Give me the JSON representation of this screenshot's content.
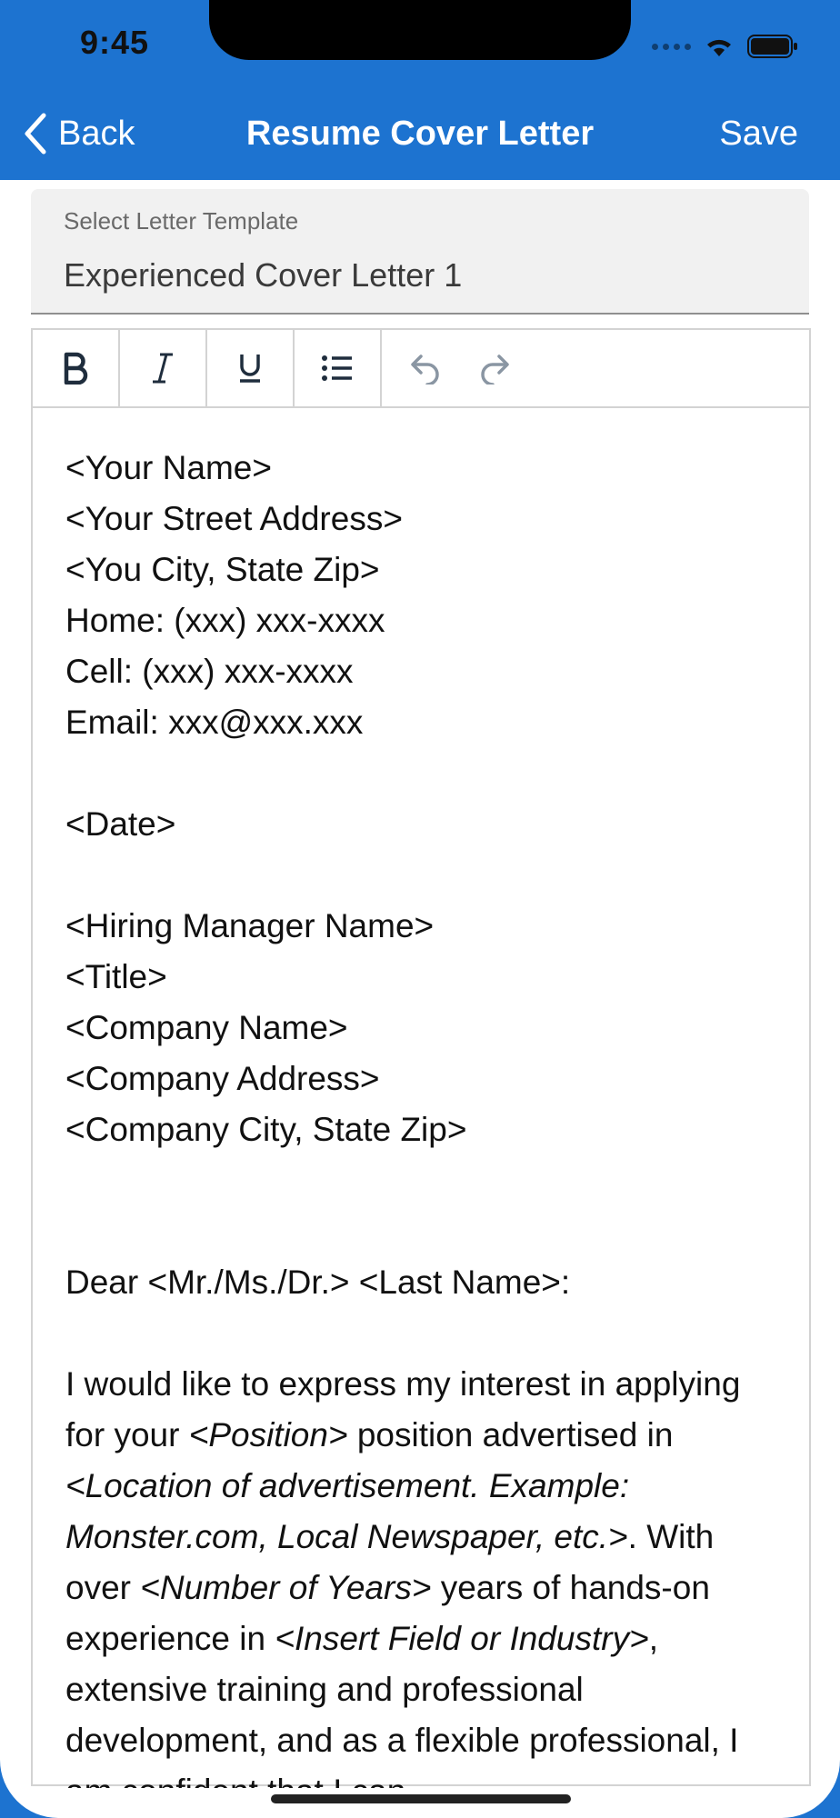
{
  "status_bar": {
    "time": "9:45"
  },
  "nav": {
    "back_label": "Back",
    "title": "Resume Cover Letter",
    "save_label": "Save"
  },
  "template": {
    "label": "Select Letter Template",
    "value": "Experienced Cover Letter 1"
  },
  "toolbar": {
    "buttons": [
      "bold-icon",
      "italic-icon",
      "underline-icon",
      "bullet-list-icon",
      "undo-icon",
      "redo-icon"
    ]
  },
  "letter": {
    "sender": [
      "<Your Name>",
      "<Your Street Address>",
      "<You City, State Zip>",
      "Home: (xxx) xxx-xxxx",
      "Cell: (xxx) xxx-xxxx",
      "Email: xxx@xxx.xxx"
    ],
    "date": "<Date>",
    "recipient": [
      "<Hiring Manager Name>",
      "<Title>",
      "<Company Name>",
      "<Company Address>",
      "<Company City, State Zip>"
    ],
    "salutation": "Dear <Mr./Ms./Dr.> <Last Name>:",
    "body": {
      "p1": "I would like to express my interest in applying for your ",
      "i1": "<Position>",
      "p2": " position advertised in ",
      "i2": "<Location of advertisement. Example: Monster.com, Local Newspaper, etc.>",
      "p3": ".  With over ",
      "i3": "<Number of Years>",
      "p4": " years of hands-on experience in ",
      "i4": "<Insert Field or Industry>",
      "p5": ", extensive training and professional development, and as a flexible professional, I am confident that I can"
    }
  },
  "colors": {
    "brand_blue": "#1d73d0"
  }
}
